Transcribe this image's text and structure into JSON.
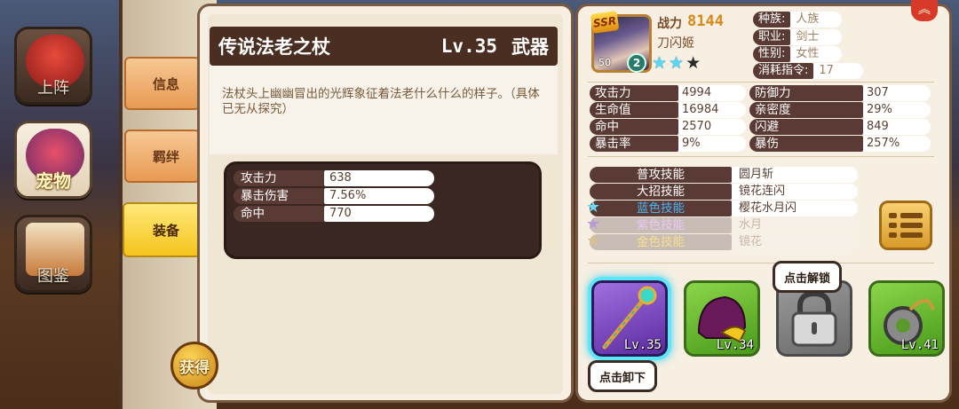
{
  "nav": {
    "items": [
      {
        "label": "上阵"
      },
      {
        "label": "宠物"
      },
      {
        "label": "图鉴"
      }
    ]
  },
  "side_tabs": [
    {
      "label": "信息"
    },
    {
      "label": "羁绊"
    },
    {
      "label": "装备"
    }
  ],
  "get_button": {
    "label": "获得"
  },
  "item": {
    "name": "传说法老之杖",
    "level": "Lv.35",
    "type": "武器",
    "description": "法杖头上幽幽冒出的光辉象征着法老什么什么的样子。（具体已无从探究）",
    "stats": [
      {
        "label": "攻击力",
        "value": "638"
      },
      {
        "label": "暴击伤害",
        "value": "7.56%"
      },
      {
        "label": "命中",
        "value": "770"
      }
    ]
  },
  "hero": {
    "rarity": "SSR",
    "level": "50",
    "rank": "2",
    "stars_filled": 2,
    "stars_total": 3,
    "power_label": "战力",
    "power_value": "8144",
    "name": "刀闪姬",
    "info": [
      {
        "label": "种族:",
        "value": "人族"
      },
      {
        "label": "职业:",
        "value": "剑士"
      },
      {
        "label": "性别:",
        "value": "女性"
      },
      {
        "label": "消耗指令:",
        "value": "17"
      }
    ],
    "attributes": [
      {
        "label": "攻击力",
        "value": "4994"
      },
      {
        "label": "防御力",
        "value": "307"
      },
      {
        "label": "生命值",
        "value": "16984"
      },
      {
        "label": "亲密度",
        "value": "29%"
      },
      {
        "label": "命中",
        "value": "2570"
      },
      {
        "label": "闪避",
        "value": "849"
      },
      {
        "label": "暴击率",
        "value": "9%"
      },
      {
        "label": "暴伤",
        "value": "257%"
      }
    ],
    "skills": [
      {
        "label": "普攻技能",
        "value": "圆月斩",
        "style": "normal"
      },
      {
        "label": "大招技能",
        "value": "镜花连闪",
        "style": "normal"
      },
      {
        "label": "蓝色技能",
        "value": "樱花水月闪",
        "style": "blue"
      },
      {
        "label": "紫色技能",
        "value": "水月",
        "style": "dim"
      },
      {
        "label": "金色技能",
        "value": "镜花",
        "style": "dim"
      }
    ]
  },
  "equipment": {
    "slots": [
      {
        "level": "Lv.35",
        "state": "selected"
      },
      {
        "level": "Lv.34",
        "state": "normal"
      },
      {
        "level": "",
        "state": "locked"
      },
      {
        "level": "Lv.41",
        "state": "normal"
      }
    ],
    "unlock_tip": "点击解锁",
    "unequip_tip": "点击卸下"
  },
  "colors": {
    "accent_gold": "#f5c41c",
    "panel_dark": "#4a2e22",
    "power": "#d88a18",
    "selection_glow": "#5ae8f8"
  }
}
